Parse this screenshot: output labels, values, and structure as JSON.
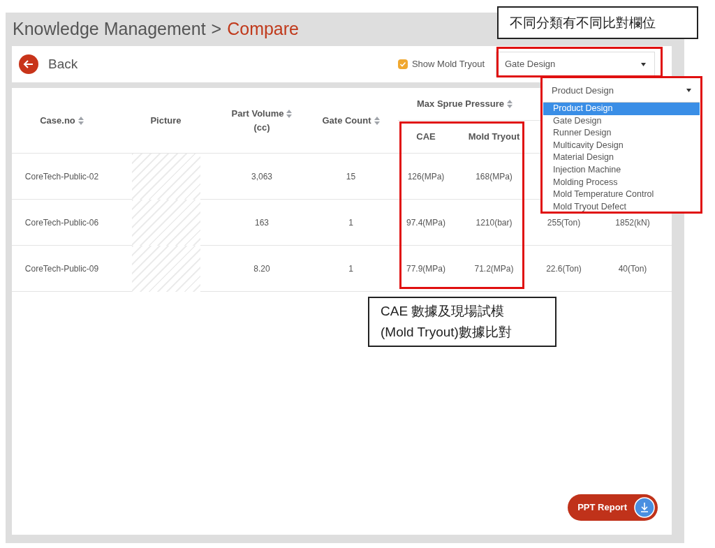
{
  "header": {
    "title": "Knowledge Management",
    "separator": ">",
    "current": "Compare"
  },
  "toolbar": {
    "back": "Back",
    "show_mold_tryout": {
      "label": "Show Mold Tryout",
      "checked": true
    },
    "category_select": "Gate Design"
  },
  "table": {
    "columns": [
      {
        "kind": "single",
        "label": "Case.no",
        "sortable": true
      },
      {
        "kind": "single",
        "label": "Picture",
        "sortable": false
      },
      {
        "kind": "single",
        "label": "Part Volume",
        "unit": "(cc)",
        "sortable": true
      },
      {
        "kind": "single",
        "label": "Gate Count",
        "sortable": true
      },
      {
        "kind": "group",
        "label": "Max Sprue Pressure",
        "sortable": true,
        "sub": [
          "CAE",
          "Mold Tryout"
        ]
      }
    ],
    "rows": [
      {
        "case_no": "CoreTech-Public-02",
        "part_volume": "3,063",
        "gate_count": "15",
        "values": [
          "126(MPa)",
          "168(MPa)"
        ]
      },
      {
        "case_no": "CoreTech-Public-06",
        "part_volume": "163",
        "gate_count": "1",
        "values": [
          "97.4(MPa)",
          "1210(bar)",
          "255(Ton)",
          "1852(kN)"
        ]
      },
      {
        "case_no": "CoreTech-Public-09",
        "part_volume": "8.20",
        "gate_count": "1",
        "values": [
          "77.9(MPa)",
          "71.2(MPa)",
          "22.6(Ton)",
          "40(Ton)"
        ]
      }
    ]
  },
  "open_dropdown": {
    "value": "Product Design",
    "options": [
      {
        "label": "Product Design",
        "selected": true
      },
      {
        "label": "Gate Design",
        "selected": false
      },
      {
        "label": "Runner Design",
        "selected": false
      },
      {
        "label": "Multicavity Design",
        "selected": false
      },
      {
        "label": "Material Design",
        "selected": false
      },
      {
        "label": "Injection Machine",
        "selected": false
      },
      {
        "label": "Molding Process",
        "selected": false
      },
      {
        "label": "Mold Temperature Control",
        "selected": false
      },
      {
        "label": "Mold Tryout Defect",
        "selected": false
      }
    ]
  },
  "annotations": [
    {
      "lines": [
        "不同分類有不同比對欄位"
      ]
    },
    {
      "lines": [
        "CAE 數據及現場試模",
        "(Mold Tryout)數據比對"
      ]
    }
  ],
  "report_button": "PPT Report"
}
